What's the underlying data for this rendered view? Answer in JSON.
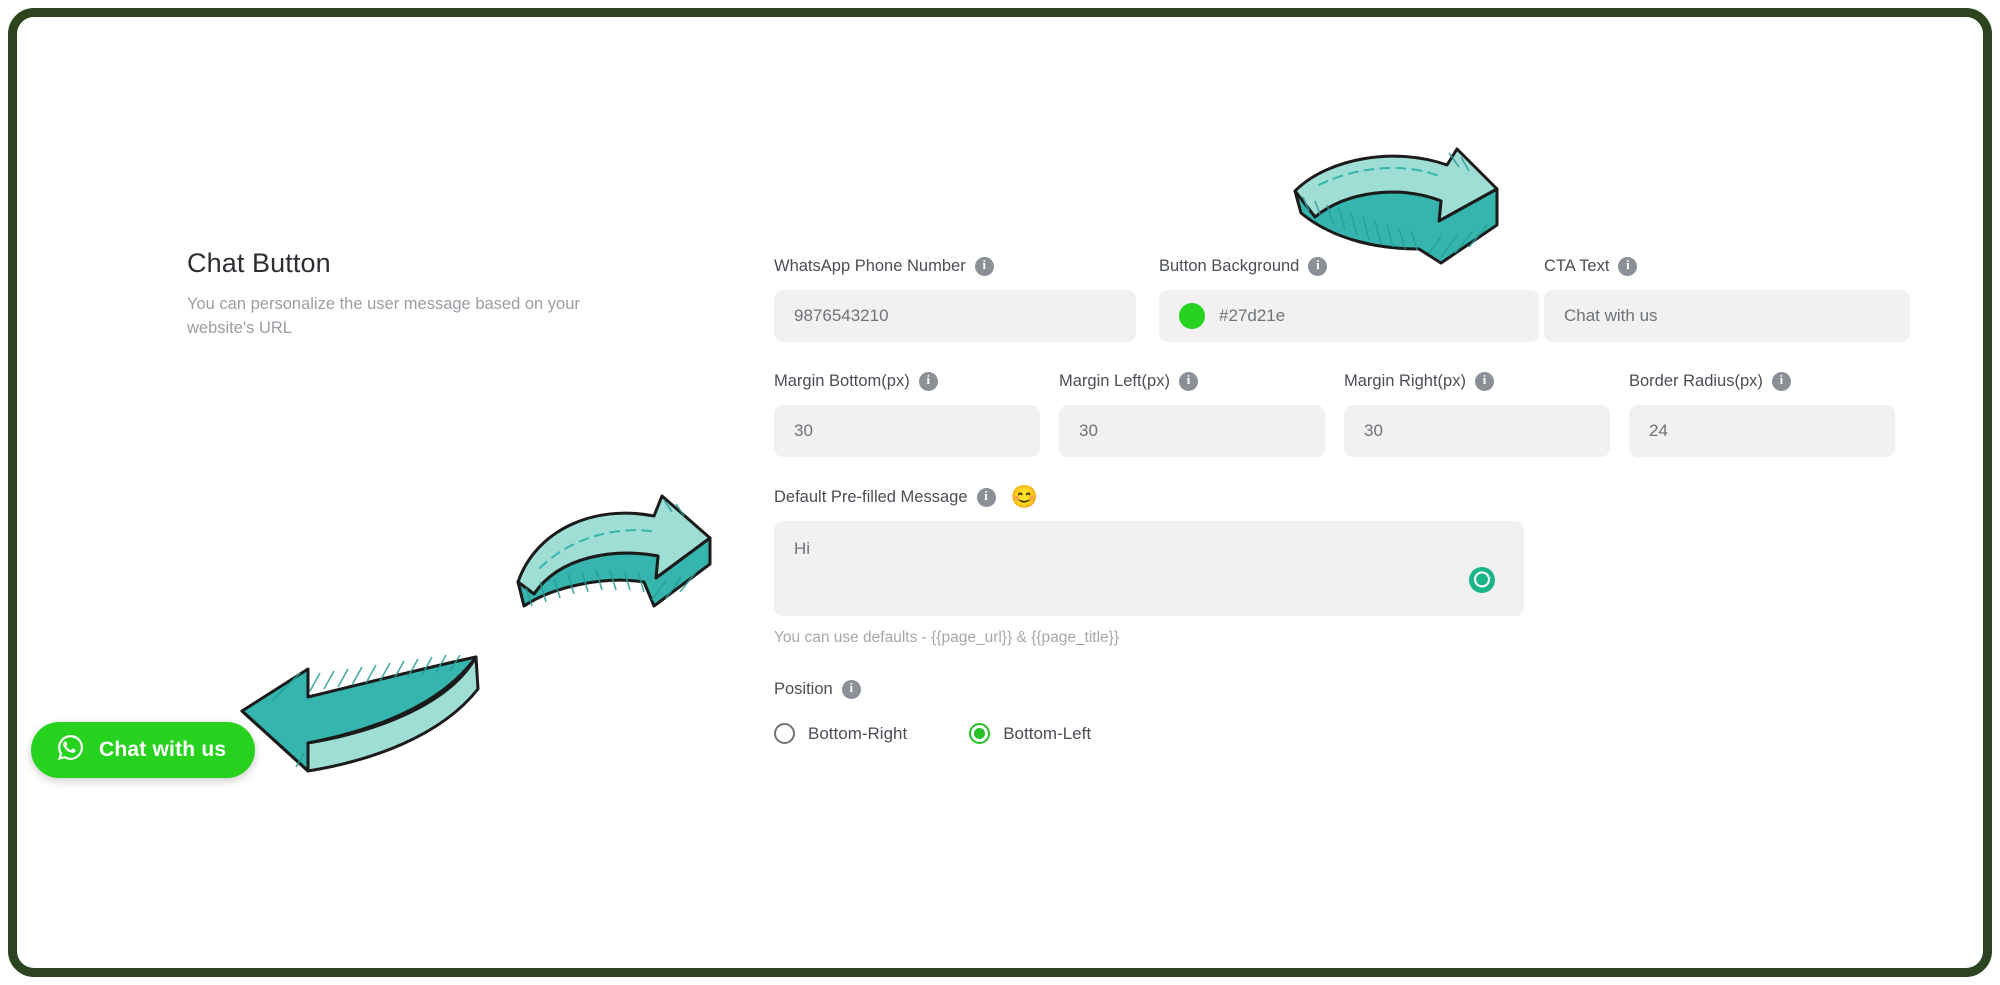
{
  "frame": {
    "border_color": "#2d4420"
  },
  "panel": {
    "title": "Chat Button",
    "subtitle": "You can personalize the user message based on your website's URL"
  },
  "info_icon_glyph": "i",
  "fields": {
    "phone": {
      "label": "WhatsApp Phone Number",
      "value": "9876543210",
      "info_icon": "info-icon"
    },
    "button_background": {
      "label": "Button Background",
      "value": "#27d21e",
      "swatch_color": "#27d21e",
      "info_icon": "info-icon"
    },
    "cta_text": {
      "label": "CTA Text",
      "value": "Chat with us",
      "info_icon": "info-icon"
    },
    "margin_bottom": {
      "label": "Margin Bottom(px)",
      "value": "30",
      "info_icon": "info-icon"
    },
    "margin_left": {
      "label": "Margin Left(px)",
      "value": "30",
      "info_icon": "info-icon"
    },
    "margin_right": {
      "label": "Margin Right(px)",
      "value": "30",
      "info_icon": "info-icon"
    },
    "border_radius": {
      "label": "Border Radius(px)",
      "value": "24",
      "info_icon": "info-icon"
    },
    "prefilled_message": {
      "label": "Default Pre-filled Message",
      "value": "Hi",
      "info_icon": "info-icon",
      "emoji": "😊",
      "emoji_name": "smiling-face-emoji",
      "reset_icon": "refresh-icon",
      "reset_icon_color": "#19b589",
      "hint": "You can use defaults - {{page_url}} & {{page_title}}"
    },
    "position": {
      "label": "Position",
      "info_icon": "info-icon",
      "selected": "Bottom-Left",
      "options": [
        {
          "label": "Bottom-Right",
          "checked": false
        },
        {
          "label": "Bottom-Left",
          "checked": true
        }
      ]
    }
  },
  "preview_button": {
    "label": "Chat with us",
    "background": "#27d21e",
    "icon": "whatsapp-icon",
    "text_color": "#ffffff"
  },
  "annotations": {
    "arrow_color": "#7fd8ce",
    "arrow_shade": "#35b5ae",
    "arrow_outline": "#1b1b1b",
    "arrows": [
      {
        "name": "arrow-pointing-to-cta-text",
        "direction": "down-right"
      },
      {
        "name": "arrow-pointing-to-prefilled-message",
        "direction": "right"
      },
      {
        "name": "arrow-pointing-to-chat-button",
        "direction": "left"
      }
    ]
  }
}
